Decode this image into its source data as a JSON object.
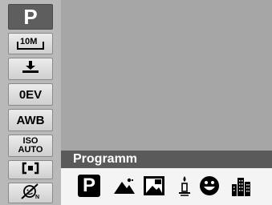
{
  "left_menu": {
    "mode": "P",
    "image_size": "10M",
    "exposure": "0EV",
    "white_balance": "AWB",
    "iso_line1": "ISO",
    "iso_line2": "AUTO",
    "icons": {
      "image_size": "image-size-icon",
      "quality": "quality-icon",
      "metering": "metering-icon",
      "face_detect": "face-detect-off-icon"
    }
  },
  "scene_panel": {
    "title": "Programm",
    "p_badge": "P",
    "icons": [
      "program-icon",
      "landscape-icon",
      "backlight-icon",
      "candle-icon",
      "smile-icon",
      "night-city-icon"
    ]
  },
  "colors": {
    "viewfinder": "#a6a6a6",
    "menu_bg": "#b9b9b9",
    "title_bar": "#5a5a5a",
    "selected_tile": "#5e5e5e"
  }
}
